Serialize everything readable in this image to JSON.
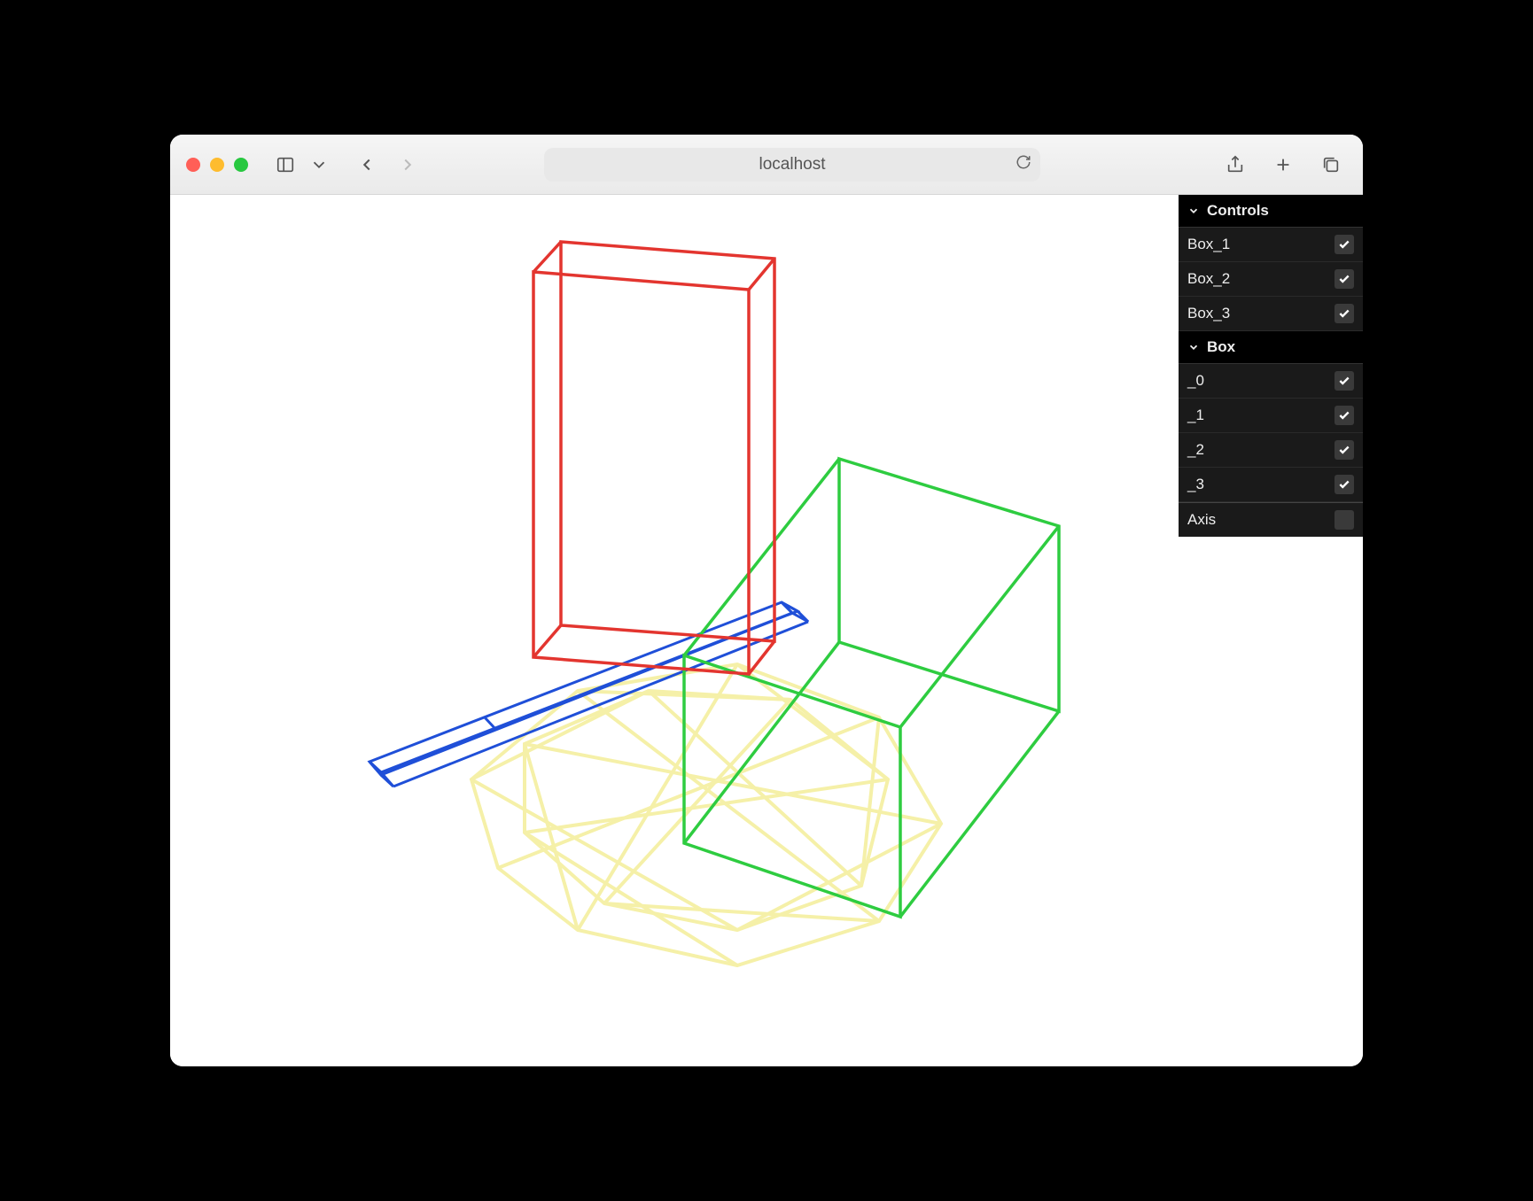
{
  "browser": {
    "url_display": "localhost"
  },
  "gui": {
    "folders": [
      {
        "title": "Controls",
        "items": [
          {
            "label": "Box_1",
            "checked": true
          },
          {
            "label": "Box_2",
            "checked": true
          },
          {
            "label": "Box_3",
            "checked": true
          }
        ]
      },
      {
        "title": "Box",
        "items": [
          {
            "label": "_0",
            "checked": true
          },
          {
            "label": "_1",
            "checked": true
          },
          {
            "label": "_2",
            "checked": true
          },
          {
            "label": "_3",
            "checked": true
          }
        ]
      }
    ],
    "axis_row": {
      "label": "Axis",
      "checked": false
    }
  },
  "scene": {
    "objects": [
      {
        "name": "red-box",
        "color": "#e3352f"
      },
      {
        "name": "green-box",
        "color": "#2ecc40"
      },
      {
        "name": "blue-box",
        "color": "#1f4fd8"
      },
      {
        "name": "yellow-geo",
        "color": "#f2e97a"
      }
    ]
  }
}
